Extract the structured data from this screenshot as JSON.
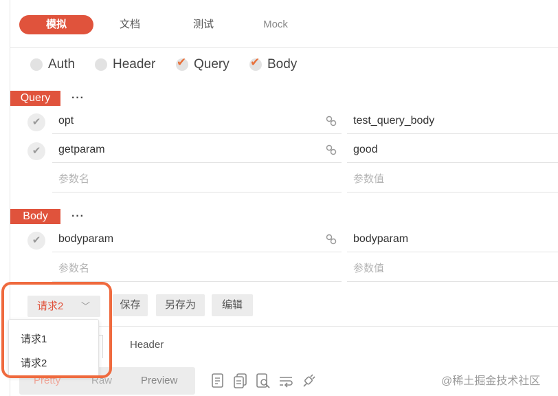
{
  "tabs": [
    {
      "label": "模拟",
      "active": true
    },
    {
      "label": "文档"
    },
    {
      "label": "测试"
    },
    {
      "label": "Mock"
    }
  ],
  "options": [
    {
      "label": "Auth",
      "checked": false
    },
    {
      "label": "Header",
      "checked": false
    },
    {
      "label": "Query",
      "checked": true
    },
    {
      "label": "Body",
      "checked": true
    }
  ],
  "query": {
    "tag": "Query",
    "more": "···",
    "rows": [
      {
        "key": "opt",
        "value": "test_query_body",
        "checked": true
      },
      {
        "key": "getparam",
        "value": "good",
        "checked": true
      }
    ],
    "key_placeholder": "参数名",
    "value_placeholder": "参数值"
  },
  "body": {
    "tag": "Body",
    "more": "···",
    "rows": [
      {
        "key": "bodyparam",
        "value": "bodyparam",
        "checked": true
      }
    ],
    "key_placeholder": "参数名",
    "value_placeholder": "参数值"
  },
  "toolbar": {
    "request_select": "请求2",
    "save_label": "保存",
    "save_as_label": "另存为",
    "edit_label": "编辑"
  },
  "request_dropdown": {
    "options": [
      "请求1",
      "请求2"
    ]
  },
  "response": {
    "header_tab": "Header",
    "formats": [
      "Pretty",
      "Raw",
      "Preview"
    ]
  },
  "icons": [
    "doc-icon",
    "copy-icon",
    "search-doc-icon",
    "wrap-icon",
    "plug-icon",
    "link-icon",
    "check-icon",
    "chevron-down-icon"
  ],
  "colors": {
    "accent": "#e0533c",
    "check": "#e8703a",
    "highlight": "#ef6a3e"
  },
  "watermark": "@稀土掘金技术社区"
}
